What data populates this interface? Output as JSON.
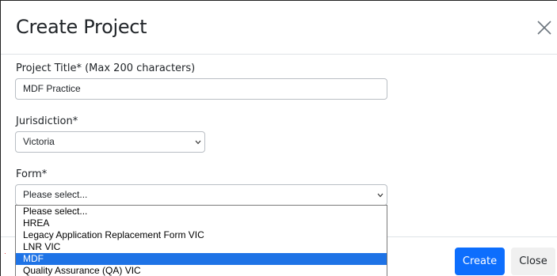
{
  "modal": {
    "title": "Create Project",
    "close_icon": "close-icon"
  },
  "fields": {
    "project_title_label": "Project Title* (Max 200 characters)",
    "project_title_value": "MDF Practice",
    "jurisdiction_label": "Jurisdiction*",
    "jurisdiction_value": "Victoria",
    "form_label": "Form*",
    "form_value": "Please select..."
  },
  "form_options": [
    {
      "label": "Please select...",
      "selected": false
    },
    {
      "label": "HREA",
      "selected": false
    },
    {
      "label": "Legacy Application Replacement Form VIC",
      "selected": false
    },
    {
      "label": "LNR VIC",
      "selected": false
    },
    {
      "label": "MDF",
      "selected": true
    },
    {
      "label": "Quality Assurance (QA) VIC",
      "selected": false
    }
  ],
  "footer": {
    "create_label": "Create",
    "close_label": "Close"
  },
  "colors": {
    "primary": "#0d6efd",
    "highlight": "#1e73e6"
  }
}
